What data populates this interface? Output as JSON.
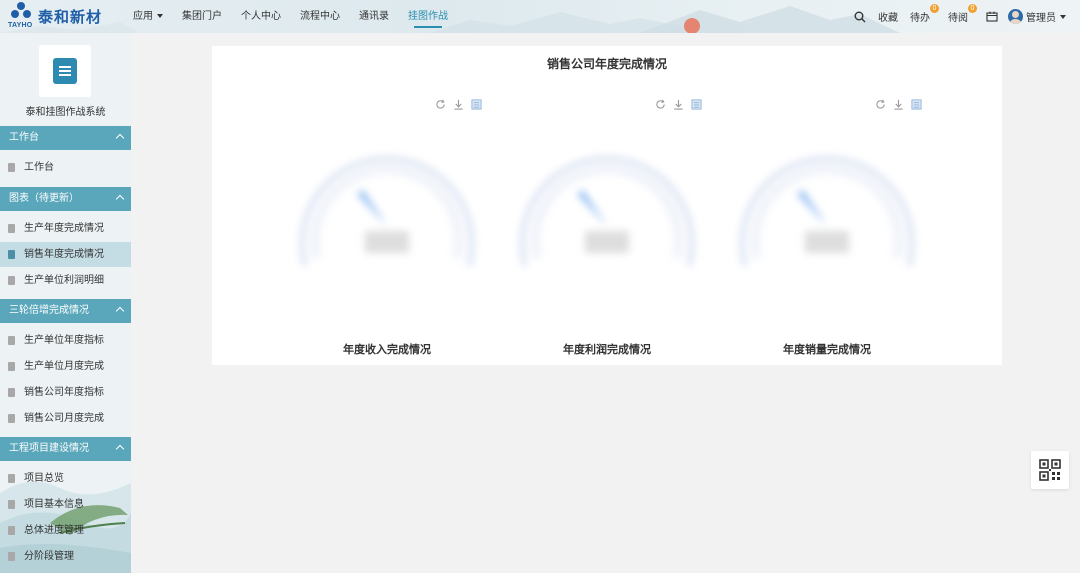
{
  "brand": {
    "name": "泰和新材",
    "en": "TAYHO"
  },
  "nav": {
    "items": [
      "应用",
      "集团门户",
      "个人中心",
      "流程中心",
      "通讯录",
      "挂图作战"
    ],
    "active_index": 5
  },
  "right_bar": {
    "favorites": "收藏",
    "todo": "待办",
    "todo_count": "0",
    "toread": "待阅",
    "toread_count": "0",
    "user": "管理员"
  },
  "sidebar": {
    "app_name": "泰和挂图作战系统",
    "sections": [
      {
        "title": "工作台",
        "items": [
          "工作台"
        ]
      },
      {
        "title": "图表（待更新）",
        "items": [
          "生产年度完成情况",
          "销售年度完成情况",
          "生产单位利润明细"
        ]
      },
      {
        "title": "三轮倍增完成情况",
        "items": [
          "生产单位年度指标",
          "生产单位月度完成",
          "销售公司年度指标",
          "销售公司月度完成"
        ]
      },
      {
        "title": "工程项目建设情况",
        "items": [
          "项目总览",
          "项目基本信息",
          "总体进度管理",
          "分阶段管理"
        ]
      }
    ],
    "active_item": "销售年度完成情况"
  },
  "main": {
    "title": "销售公司年度完成情况",
    "gauges": [
      {
        "label": "年度收入完成情况"
      },
      {
        "label": "年度利润完成情况"
      },
      {
        "label": "年度销量完成情况"
      }
    ],
    "tool_icons": [
      "refresh-icon",
      "download-icon",
      "data-view-icon"
    ]
  },
  "colors": {
    "accent": "#2a8fb0",
    "section": "#5aa6ba",
    "active_item": "#c4dde4",
    "brand": "#1f5fa8",
    "gauge_pointer": "#3a86e8"
  }
}
